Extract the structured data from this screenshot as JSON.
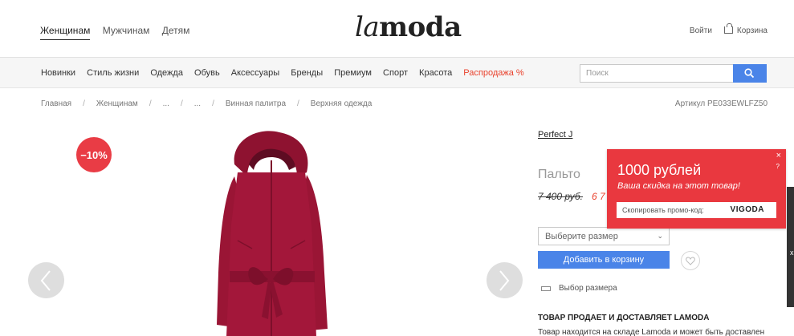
{
  "header": {
    "gender_tabs": [
      "Женщинам",
      "Мужчинам",
      "Детям"
    ],
    "logo_la": "la",
    "logo_moda": "moda",
    "login": "Войти",
    "cart": "Корзина"
  },
  "nav": {
    "items": [
      "Новинки",
      "Стиль жизни",
      "Одежда",
      "Обувь",
      "Аксессуары",
      "Бренды",
      "Премиум",
      "Спорт",
      "Красота"
    ],
    "sale": "Распродажа %"
  },
  "search": {
    "placeholder": "Поиск"
  },
  "breadcrumb": [
    "Главная",
    "Женщинам",
    "...",
    "...",
    "Винная палитра",
    "Верхняя одежда"
  ],
  "sku": "Артикул PE033EWLFZ50",
  "product": {
    "discount_badge": "−10%",
    "brand": "Perfect J",
    "title": "Пальто",
    "price_old": "7 400 руб.",
    "price_new": "6 7",
    "size_placeholder": "Выберите размер",
    "add_to_cart": "Добавить в корзину",
    "size_guide": "Выбор размера",
    "delivery_heading": "ТОВАР ПРОДАЕТ И ДОСТАВЛЯЕТ LAMODA",
    "delivery_text": "Товар находится на складе Lamoda и может быть доставлен"
  },
  "promo": {
    "amount": "1000 рублей",
    "subtitle": "Ваша скидка на этот товар!",
    "close": "×",
    "help": "?",
    "code_label": "Скопировать промо-код:",
    "code": "VIGODA"
  },
  "edge_widget": {
    "glyph": "x"
  },
  "colors": {
    "accent_blue": "#4a84e8",
    "sale_red": "#e9412c",
    "promo_red": "#e9383f",
    "coat_burgundy": "#a3173a"
  }
}
